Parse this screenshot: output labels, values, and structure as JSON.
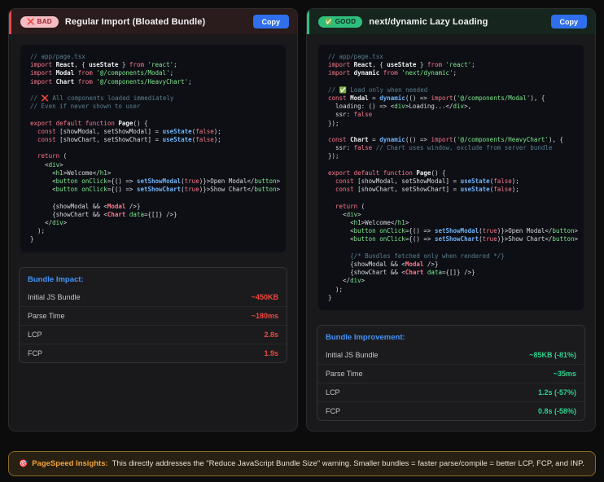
{
  "panels": [
    {
      "badge": {
        "icon": "❌",
        "label": "BAD"
      },
      "title": "Regular Import (Bloated Bundle)",
      "copy_label": "Copy",
      "accent": "#e5484d",
      "code": [
        [
          [
            "c",
            "// app/page.tsx"
          ]
        ],
        [
          [
            "k",
            "import"
          ],
          [
            "p",
            " "
          ],
          [
            "b",
            "React"
          ],
          [
            "p",
            ", { "
          ],
          [
            "b",
            "useState"
          ],
          [
            "p",
            " } "
          ],
          [
            "k",
            "from"
          ],
          [
            "p",
            " "
          ],
          [
            "s",
            "'react'"
          ],
          [
            "p",
            ";"
          ]
        ],
        [
          [
            "k",
            "import"
          ],
          [
            "p",
            " "
          ],
          [
            "b",
            "Modal"
          ],
          [
            "p",
            " "
          ],
          [
            "k",
            "from"
          ],
          [
            "p",
            " "
          ],
          [
            "s",
            "'@/components/Modal'"
          ],
          [
            "p",
            ";"
          ]
        ],
        [
          [
            "k",
            "import"
          ],
          [
            "p",
            " "
          ],
          [
            "b",
            "Chart"
          ],
          [
            "p",
            " "
          ],
          [
            "k",
            "from"
          ],
          [
            "p",
            " "
          ],
          [
            "s",
            "'@/components/HeavyChart'"
          ],
          [
            "p",
            ";"
          ]
        ],
        [],
        [
          [
            "c",
            "// ❌ All components loaded immediately"
          ]
        ],
        [
          [
            "c",
            "// Even if never shown to user"
          ]
        ],
        [],
        [
          [
            "k",
            "export default function"
          ],
          [
            "p",
            " "
          ],
          [
            "b",
            "Page"
          ],
          [
            "p",
            "() {"
          ]
        ],
        [
          [
            "p",
            "  "
          ],
          [
            "k",
            "const"
          ],
          [
            "p",
            " [showModal, setShowModal] = "
          ],
          [
            "f",
            "useState"
          ],
          [
            "p",
            "("
          ],
          [
            "k",
            "false"
          ],
          [
            "p",
            ");"
          ]
        ],
        [
          [
            "p",
            "  "
          ],
          [
            "k",
            "const"
          ],
          [
            "p",
            " [showChart, setShowChart] = "
          ],
          [
            "f",
            "useState"
          ],
          [
            "p",
            "("
          ],
          [
            "k",
            "false"
          ],
          [
            "p",
            ");"
          ]
        ],
        [],
        [
          [
            "p",
            "  "
          ],
          [
            "k",
            "return"
          ],
          [
            "p",
            " ("
          ]
        ],
        [
          [
            "p",
            "    <"
          ],
          [
            "t",
            "div"
          ],
          [
            "p",
            ">"
          ]
        ],
        [
          [
            "p",
            "      <"
          ],
          [
            "t",
            "h1"
          ],
          [
            "p",
            ">Welcome</"
          ],
          [
            "t",
            "h1"
          ],
          [
            "p",
            ">"
          ]
        ],
        [
          [
            "p",
            "      <"
          ],
          [
            "t",
            "button"
          ],
          [
            "p",
            " "
          ],
          [
            "t",
            "onClick"
          ],
          [
            "p",
            "={() => "
          ],
          [
            "f",
            "setShowModal"
          ],
          [
            "p",
            "("
          ],
          [
            "k",
            "true"
          ],
          [
            "p",
            ")}>Open Modal</"
          ],
          [
            "t",
            "button"
          ],
          [
            "p",
            ">"
          ]
        ],
        [
          [
            "p",
            "      <"
          ],
          [
            "t",
            "button"
          ],
          [
            "p",
            " "
          ],
          [
            "t",
            "onClick"
          ],
          [
            "p",
            "={() => "
          ],
          [
            "f",
            "setShowChart"
          ],
          [
            "p",
            "("
          ],
          [
            "k",
            "true"
          ],
          [
            "p",
            ")}>Show Chart</"
          ],
          [
            "t",
            "button"
          ],
          [
            "p",
            ">"
          ]
        ],
        [],
        [
          [
            "p",
            "      {showModal && <"
          ],
          [
            "m",
            "Modal"
          ],
          [
            "p",
            " />}"
          ]
        ],
        [
          [
            "p",
            "      {showChart && <"
          ],
          [
            "m",
            "Chart"
          ],
          [
            "p",
            " "
          ],
          [
            "t",
            "data"
          ],
          [
            "p",
            "={[]} />}"
          ]
        ],
        [
          [
            "p",
            "    </"
          ],
          [
            "t",
            "div"
          ],
          [
            "p",
            ">"
          ]
        ],
        [
          [
            "p",
            "  );"
          ]
        ],
        [
          [
            "p",
            "}"
          ]
        ]
      ],
      "metrics": {
        "title": "Bundle Impact:",
        "rows": [
          {
            "label": "Initial JS Bundle",
            "value": "~450KB"
          },
          {
            "label": "Parse Time",
            "value": "~180ms"
          },
          {
            "label": "LCP",
            "value": "2.8s"
          },
          {
            "label": "FCP",
            "value": "1.9s"
          }
        ]
      }
    },
    {
      "badge": {
        "icon": "✅",
        "label": "GOOD"
      },
      "title": "next/dynamic Lazy Loading",
      "copy_label": "Copy",
      "accent": "#2ebe7d",
      "code": [
        [
          [
            "c",
            "// app/page.tsx"
          ]
        ],
        [
          [
            "k",
            "import"
          ],
          [
            "p",
            " "
          ],
          [
            "b",
            "React"
          ],
          [
            "p",
            ", { "
          ],
          [
            "b",
            "useState"
          ],
          [
            "p",
            " } "
          ],
          [
            "k",
            "from"
          ],
          [
            "p",
            " "
          ],
          [
            "s",
            "'react'"
          ],
          [
            "p",
            ";"
          ]
        ],
        [
          [
            "k",
            "import"
          ],
          [
            "p",
            " "
          ],
          [
            "b",
            "dynamic"
          ],
          [
            "p",
            " "
          ],
          [
            "k",
            "from"
          ],
          [
            "p",
            " "
          ],
          [
            "s",
            "'next/dynamic'"
          ],
          [
            "p",
            ";"
          ]
        ],
        [],
        [
          [
            "c",
            "// ✅ Load only when needed"
          ]
        ],
        [
          [
            "k",
            "const"
          ],
          [
            "p",
            " "
          ],
          [
            "b",
            "Modal"
          ],
          [
            "p",
            " = "
          ],
          [
            "f",
            "dynamic"
          ],
          [
            "p",
            "(() => "
          ],
          [
            "k",
            "import"
          ],
          [
            "p",
            "("
          ],
          [
            "s",
            "'@/components/Modal'"
          ],
          [
            "p",
            "), {"
          ]
        ],
        [
          [
            "p",
            "  loading: () => <"
          ],
          [
            "t",
            "div"
          ],
          [
            "p",
            ">Loading...</"
          ],
          [
            "t",
            "div"
          ],
          [
            "p",
            ">,"
          ]
        ],
        [
          [
            "p",
            "  ssr: "
          ],
          [
            "k",
            "false"
          ]
        ],
        [
          [
            "p",
            "});"
          ]
        ],
        [],
        [
          [
            "k",
            "const"
          ],
          [
            "p",
            " "
          ],
          [
            "b",
            "Chart"
          ],
          [
            "p",
            " = "
          ],
          [
            "f",
            "dynamic"
          ],
          [
            "p",
            "(() => "
          ],
          [
            "k",
            "import"
          ],
          [
            "p",
            "("
          ],
          [
            "s",
            "'@/components/HeavyChart'"
          ],
          [
            "p",
            "), {"
          ]
        ],
        [
          [
            "p",
            "  ssr: "
          ],
          [
            "k",
            "false"
          ],
          [
            "p",
            " "
          ],
          [
            "c",
            "// Chart uses window, exclude from server bundle"
          ]
        ],
        [
          [
            "p",
            "});"
          ]
        ],
        [],
        [
          [
            "k",
            "export default function"
          ],
          [
            "p",
            " "
          ],
          [
            "b",
            "Page"
          ],
          [
            "p",
            "() {"
          ]
        ],
        [
          [
            "p",
            "  "
          ],
          [
            "k",
            "const"
          ],
          [
            "p",
            " [showModal, setShowModal] = "
          ],
          [
            "f",
            "useState"
          ],
          [
            "p",
            "("
          ],
          [
            "k",
            "false"
          ],
          [
            "p",
            ");"
          ]
        ],
        [
          [
            "p",
            "  "
          ],
          [
            "k",
            "const"
          ],
          [
            "p",
            " [showChart, setShowChart] = "
          ],
          [
            "f",
            "useState"
          ],
          [
            "p",
            "("
          ],
          [
            "k",
            "false"
          ],
          [
            "p",
            ");"
          ]
        ],
        [],
        [
          [
            "p",
            "  "
          ],
          [
            "k",
            "return"
          ],
          [
            "p",
            " ("
          ]
        ],
        [
          [
            "p",
            "    <"
          ],
          [
            "t",
            "div"
          ],
          [
            "p",
            ">"
          ]
        ],
        [
          [
            "p",
            "      <"
          ],
          [
            "t",
            "h1"
          ],
          [
            "p",
            ">Welcome</"
          ],
          [
            "t",
            "h1"
          ],
          [
            "p",
            ">"
          ]
        ],
        [
          [
            "p",
            "      <"
          ],
          [
            "t",
            "button"
          ],
          [
            "p",
            " "
          ],
          [
            "t",
            "onClick"
          ],
          [
            "p",
            "={() => "
          ],
          [
            "f",
            "setShowModal"
          ],
          [
            "p",
            "("
          ],
          [
            "k",
            "true"
          ],
          [
            "p",
            ")}>Open Modal</"
          ],
          [
            "t",
            "button"
          ],
          [
            "p",
            ">"
          ]
        ],
        [
          [
            "p",
            "      <"
          ],
          [
            "t",
            "button"
          ],
          [
            "p",
            " "
          ],
          [
            "t",
            "onClick"
          ],
          [
            "p",
            "={() => "
          ],
          [
            "f",
            "setShowChart"
          ],
          [
            "p",
            "("
          ],
          [
            "k",
            "true"
          ],
          [
            "p",
            ")}>Show Chart</"
          ],
          [
            "t",
            "button"
          ],
          [
            "p",
            ">"
          ]
        ],
        [],
        [
          [
            "p",
            "      "
          ],
          [
            "c",
            "{/* Bundles fetched only when rendered */}"
          ]
        ],
        [
          [
            "p",
            "      {showModal && <"
          ],
          [
            "m",
            "Modal"
          ],
          [
            "p",
            " />}"
          ]
        ],
        [
          [
            "p",
            "      {showChart && <"
          ],
          [
            "m",
            "Chart"
          ],
          [
            "p",
            " "
          ],
          [
            "t",
            "data"
          ],
          [
            "p",
            "={[]} />}"
          ]
        ],
        [
          [
            "p",
            "    </"
          ],
          [
            "t",
            "div"
          ],
          [
            "p",
            ">"
          ]
        ],
        [
          [
            "p",
            "  );"
          ]
        ],
        [
          [
            "p",
            "}"
          ]
        ]
      ],
      "metrics": {
        "title": "Bundle Improvement:",
        "rows": [
          {
            "label": "Initial JS Bundle",
            "value": "~85KB (-81%)"
          },
          {
            "label": "Parse Time",
            "value": "~35ms"
          },
          {
            "label": "LCP",
            "value": "1.2s (-57%)"
          },
          {
            "label": "FCP",
            "value": "0.8s (-58%)"
          }
        ]
      }
    }
  ],
  "note": {
    "icon": "🎯",
    "title": "PageSpeed Insights:",
    "text": "This directly addresses the \"Reduce JavaScript Bundle Size\" warning. Smaller bundles = faster parse/compile = better LCP, FCP, and INP."
  },
  "colors": {
    "bad_accent": "#e5484d",
    "good_accent": "#2ebe7d",
    "bad_value": "#f1473e",
    "good_value": "#2fd08c",
    "metrics_title": "#4493f8",
    "copy_button": "#2f6feb",
    "note_accent": "#f2a33c"
  }
}
